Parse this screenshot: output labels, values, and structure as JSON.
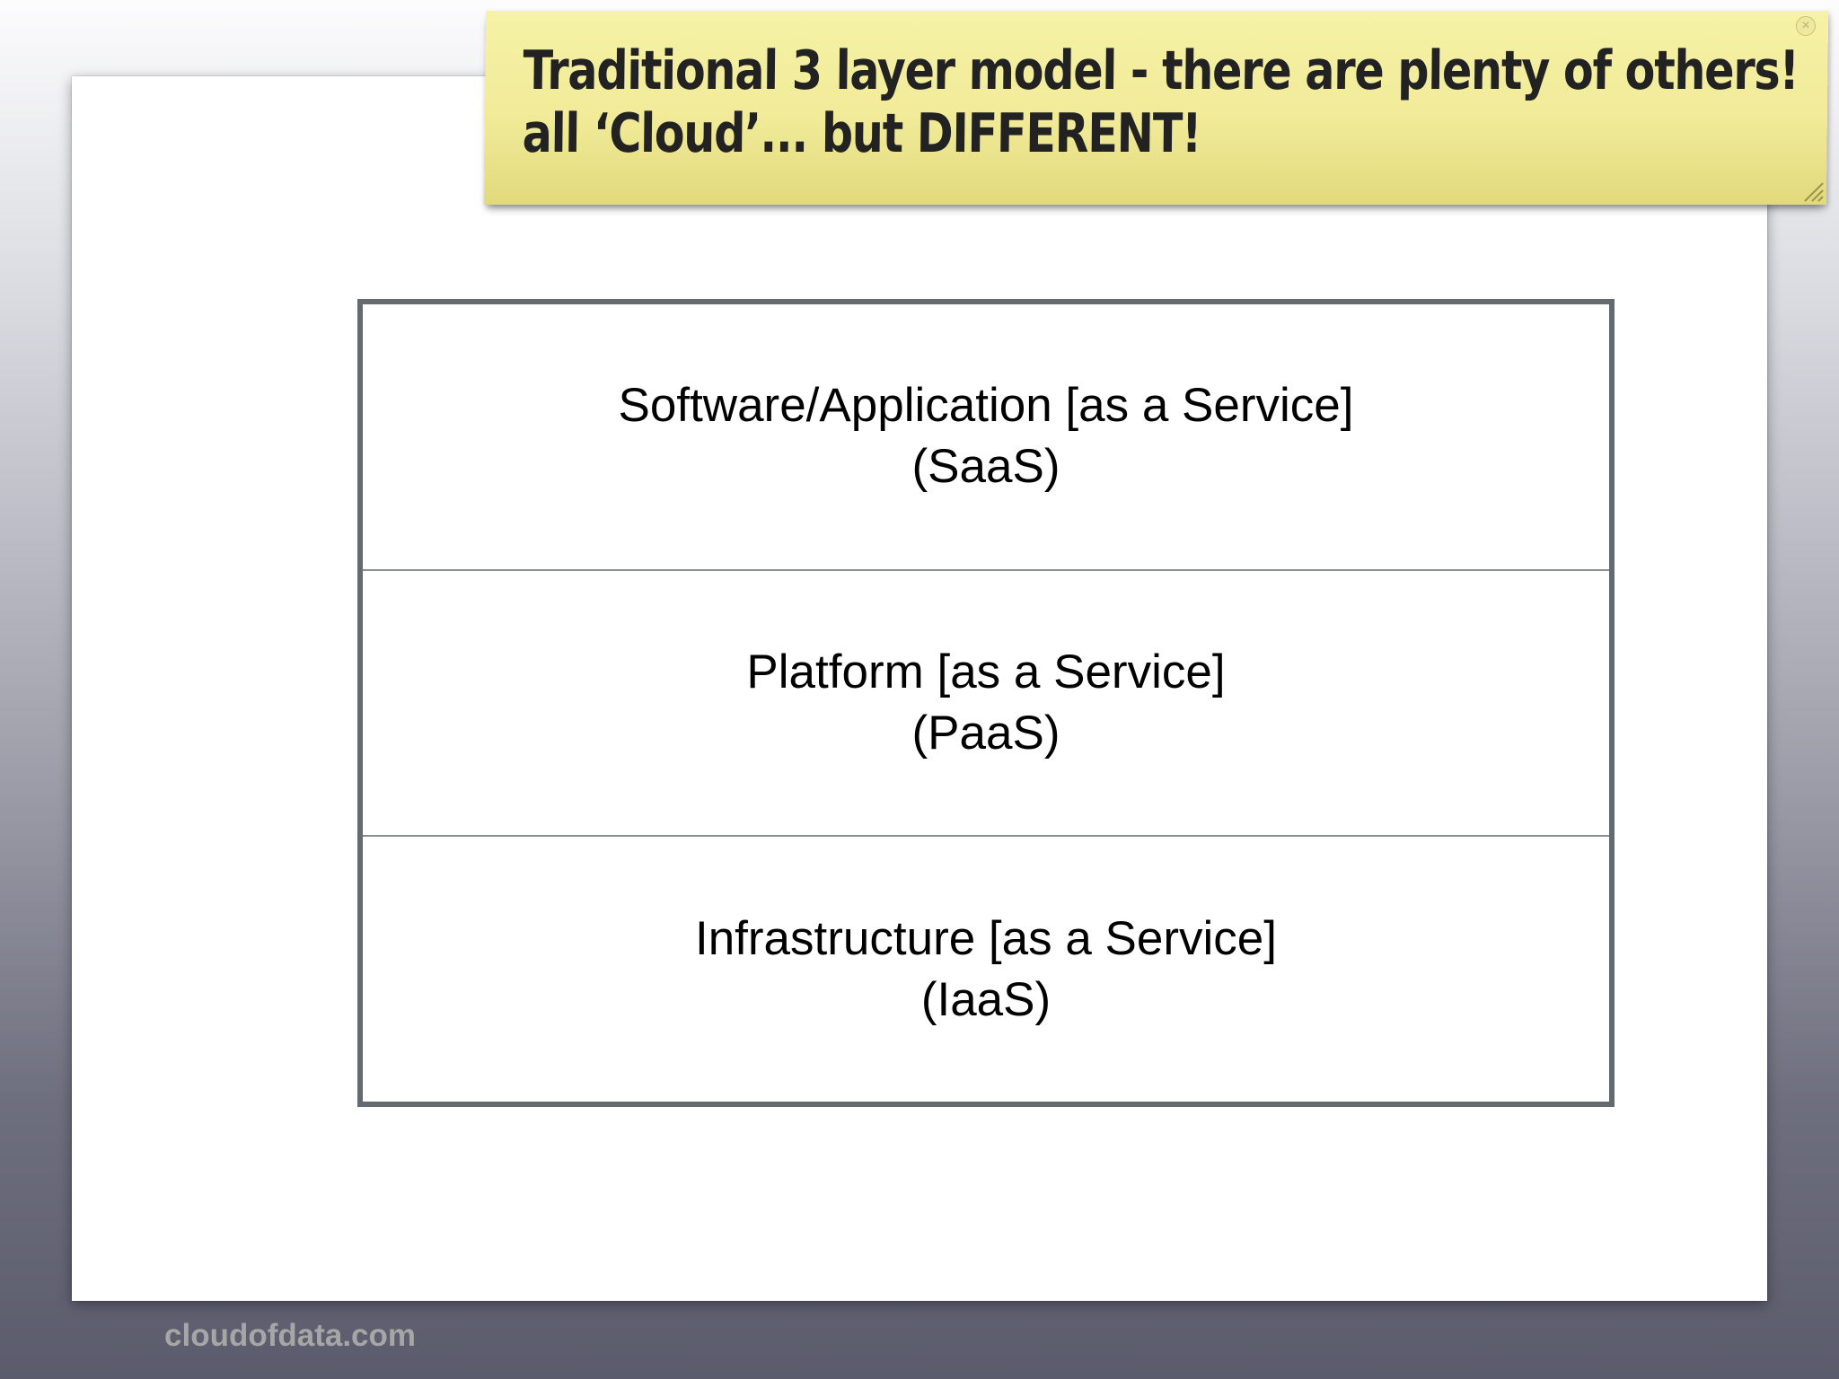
{
  "note": {
    "line1": "Traditional 3 layer model - there are plenty of others!",
    "line2": "all ‘Cloud’... but DIFFERENT!",
    "close_glyph": "×"
  },
  "layers": [
    {
      "name": "Software/Application [as a Service]",
      "abbr": "(SaaS)"
    },
    {
      "name": "Platform [as a Service]",
      "abbr": "(PaaS)"
    },
    {
      "name": "Infrastructure [as a Service]",
      "abbr": "(IaaS)"
    }
  ],
  "footer": {
    "watermark": "cloudofdata.com"
  },
  "colors": {
    "note_background": "#f2ec9b",
    "layer_border": "#636a70",
    "watermark": "#a6a6a6"
  },
  "icons": {
    "close": "close-icon",
    "resize": "resize-grip-icon"
  }
}
